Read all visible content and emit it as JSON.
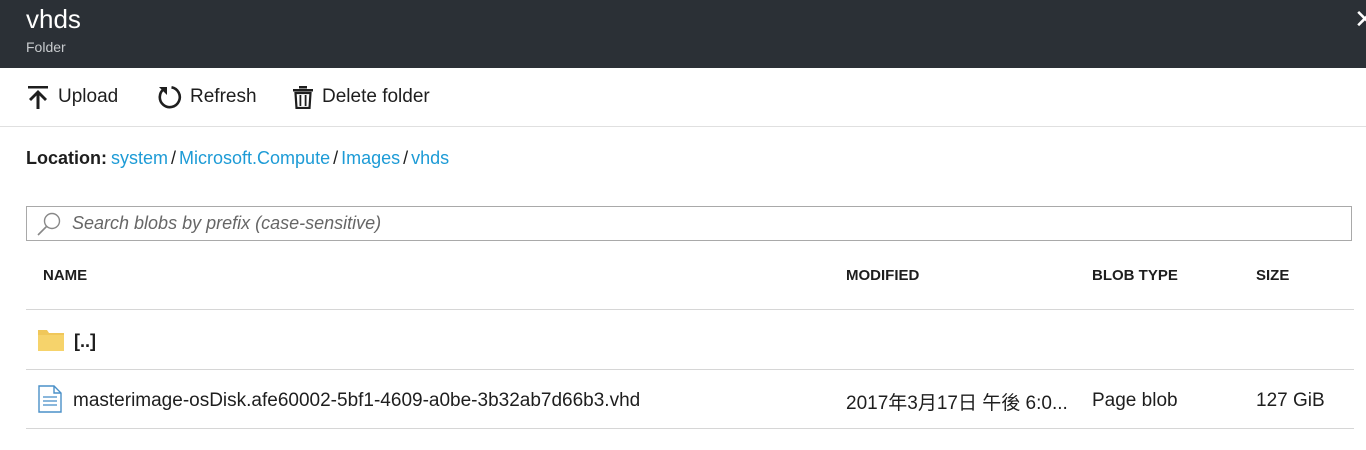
{
  "header": {
    "title": "vhds",
    "subtitle": "Folder",
    "close_glyph": "✕"
  },
  "toolbar": {
    "upload_label": "Upload",
    "refresh_label": "Refresh",
    "delete_label": "Delete folder"
  },
  "location": {
    "label": "Location:",
    "segments": [
      "system",
      "Microsoft.Compute",
      "Images",
      "vhds"
    ],
    "separator": "/"
  },
  "search": {
    "placeholder": "Search blobs by prefix (case-sensitive)"
  },
  "table": {
    "headers": [
      "NAME",
      "MODIFIED",
      "BLOB TYPE",
      "SIZE"
    ],
    "rows": [
      {
        "icon": "folder-icon",
        "name": "[..]",
        "modified": "",
        "blob_type": "",
        "size": ""
      },
      {
        "icon": "file-icon",
        "name": "masterimage-osDisk.afe60002-5bf1-4609-a0be-3b32ab7d66b3.vhd",
        "modified": "2017年3月17日 午後 6:0...",
        "blob_type": "Page blob",
        "size": "127 GiB"
      }
    ]
  },
  "colors": {
    "header_bg": "#2b3036",
    "link": "#1d9bd6",
    "folder": "#f6d36b"
  }
}
